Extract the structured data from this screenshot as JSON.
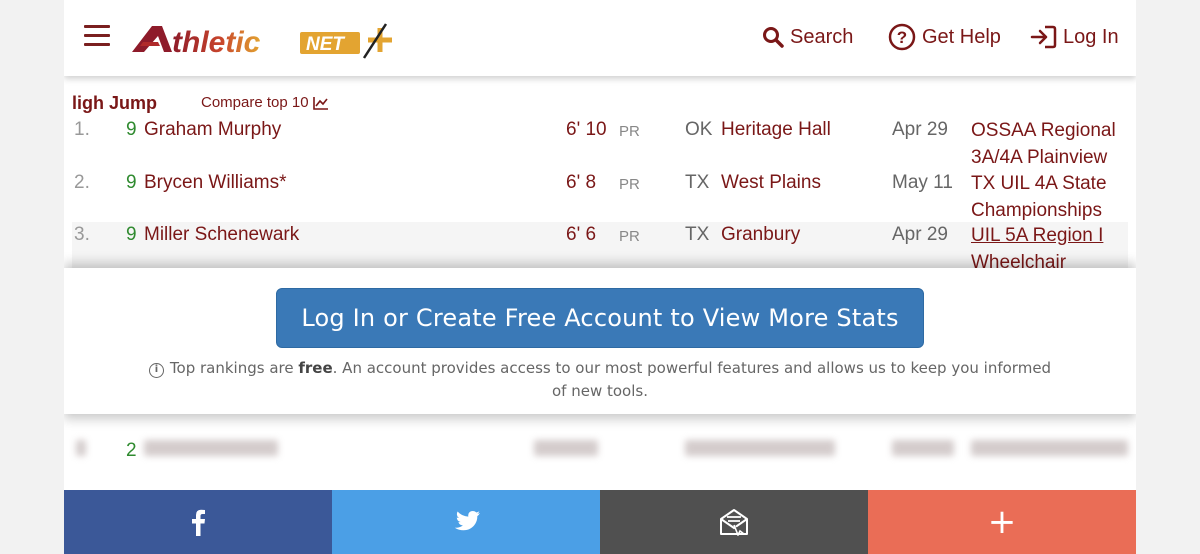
{
  "header": {
    "logo_text": "AthleticNET",
    "logo_word": "thletic",
    "logo_net": "NET",
    "nav": {
      "search": "Search",
      "help": "Get Help",
      "login": "Log In"
    }
  },
  "rankings": {
    "event": "ligh Jump",
    "compare_label": "Compare top 10",
    "rows": [
      {
        "rank": "1.",
        "grade": "9",
        "name": "Graham Murphy",
        "mark": "6' 10",
        "pr": "PR",
        "state": "OK",
        "school": "Heritage Hall",
        "date": "Apr 29",
        "meet": "OSSAA Regional 3A/4A Plainview"
      },
      {
        "rank": "2.",
        "grade": "9",
        "name": "Brycen Williams*",
        "mark": "6' 8",
        "pr": "PR",
        "state": "TX",
        "school": "West Plains",
        "date": "May 11",
        "meet": "TX UIL 4A State Championships"
      },
      {
        "rank": "3.",
        "grade": "9",
        "name": "Miller Schenewark",
        "mark": "6' 6",
        "pr": "PR",
        "state": "TX",
        "school": "Granbury",
        "date": "Apr 29",
        "meet": "UIL 5A Region I Wheelchair"
      }
    ],
    "blurred_grade": "2"
  },
  "overlay": {
    "cta": "Log In or Create Free Account to View More Stats",
    "note_pre": "Top rankings are ",
    "note_bold": "free",
    "note_post": ". An account provides access to our most powerful features and allows us to keep you informed of new tools."
  },
  "share": {
    "facebook_icon": "facebook-icon",
    "twitter_icon": "twitter-icon",
    "email_icon": "email-icon",
    "more": "+"
  },
  "colors": {
    "brand": "#7a1717",
    "grade": "#2f8a2f",
    "cta": "#3a79b7",
    "facebook": "#3b5898",
    "twitter": "#4b9fe6",
    "email": "#505050",
    "more": "#ea6d56"
  }
}
